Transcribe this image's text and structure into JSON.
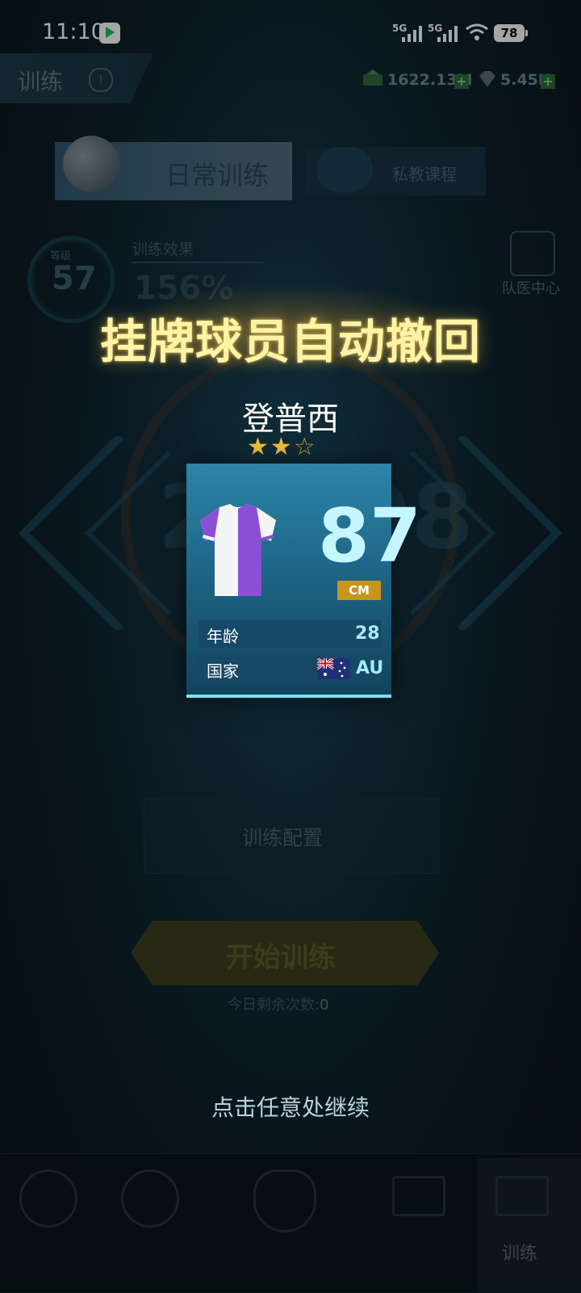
{
  "status_bar": {
    "time": "11:10",
    "signal1": "5G",
    "signal2": "5G",
    "battery": "78"
  },
  "header": {
    "title": "训练",
    "info_mark": "!",
    "currency1": "1622.13M",
    "currency2": "5.45K",
    "plus": "+"
  },
  "tabs": {
    "daily": "日常训练",
    "private": "私教课程"
  },
  "training": {
    "gauge_label": "等级",
    "gauge_value": "57",
    "effect_title": "训练效果",
    "effect_value": "156%",
    "doctor_label": "队医中心",
    "big_number": "25108"
  },
  "buttons": {
    "config": "训练配置",
    "start": "开始训练",
    "remaining_label": "今日剩余次数:",
    "remaining_value": "0"
  },
  "bottom_nav": {
    "active_label": "训练"
  },
  "popup": {
    "title": "挂牌球员自动撤回",
    "player_name": "登普西",
    "stars_filled": 2,
    "stars_total": 3,
    "rating": "87",
    "position": "CM",
    "age_label": "年龄",
    "age_value": "28",
    "country_label": "国家",
    "country_value": "AU",
    "continue_hint": "点击任意处继续"
  },
  "colors": {
    "title_glow": "#fff4a6",
    "card": "#1d6283",
    "position_badge": "#c6951c",
    "jersey_purple": "#8b4fd6"
  }
}
